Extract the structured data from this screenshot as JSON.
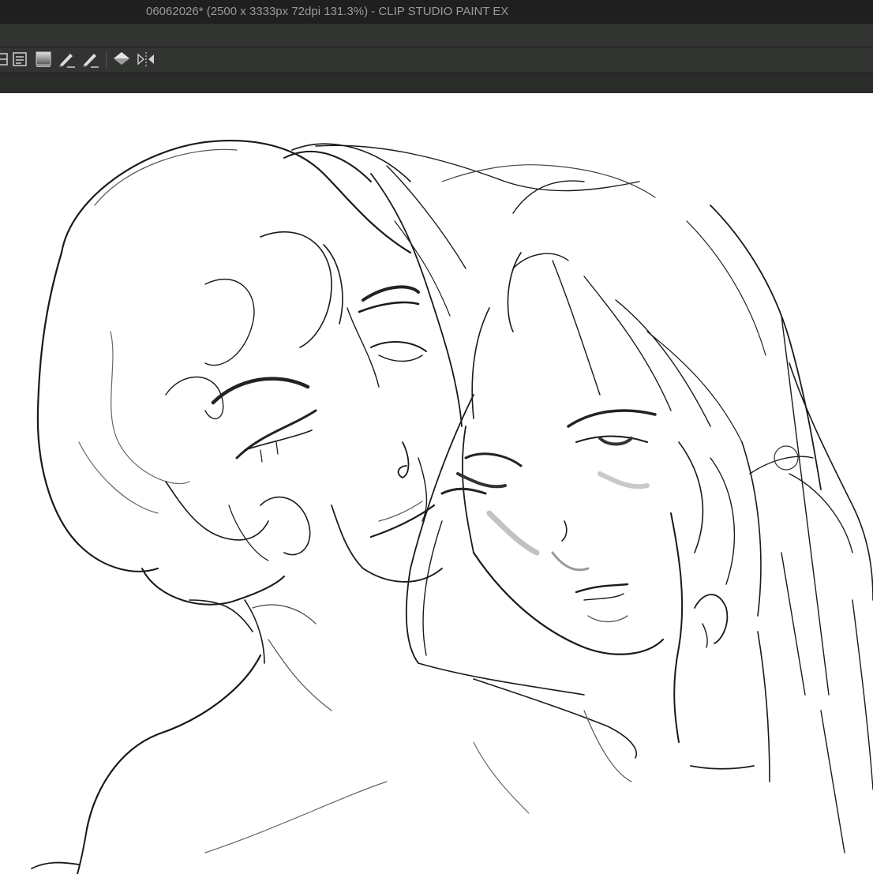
{
  "window": {
    "title": "06062026* (2500 x 3333px 72dpi 131.3%)  - CLIP STUDIO PAINT EX"
  },
  "toolbar": {
    "buttons": [
      {
        "name": "layer-panel-icon"
      },
      {
        "name": "layer-property-icon"
      },
      {
        "name": "gradient-icon"
      },
      {
        "name": "pen-icon"
      },
      {
        "name": "pen-alt-icon"
      },
      {
        "name": "fill-icon"
      },
      {
        "name": "flip-horizontal-icon"
      }
    ]
  },
  "canvas": {
    "background": "#ffffff",
    "line_color": "#1a1a1a",
    "content": "sketch-two-figures"
  }
}
